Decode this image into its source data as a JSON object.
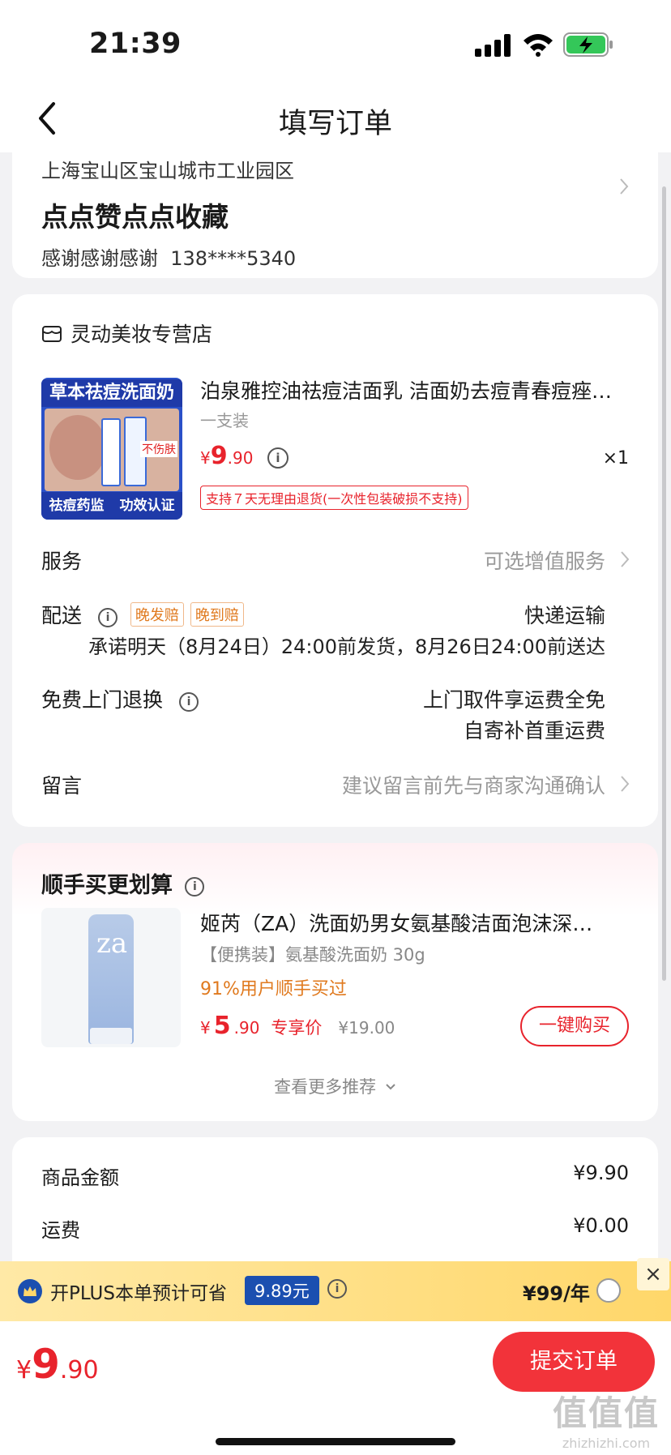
{
  "status_bar": {
    "time": "21:39"
  },
  "nav": {
    "title": "填写订单"
  },
  "address": {
    "region": "上海宝山区宝山城市工业园区",
    "detail": "点点赞点点收藏",
    "name": "感谢感谢感谢",
    "phone": "138****5340"
  },
  "shop": {
    "name": "灵动美妆专营店"
  },
  "product": {
    "name": "泊泉雅控油祛痘洁面乳 洁面奶去痘青春痘痤疮…",
    "spec": "一支装",
    "price_currency": "¥",
    "price_int": "9",
    "price_dec": ".90",
    "qty": "×1",
    "return_policy": "支持７天无理由退货(一次性包装破损不支持)",
    "thumb_title": "草本祛痘洗面奶",
    "thumb_tag": "不伤肤",
    "thumb_bottom_left": "祛痘药监",
    "thumb_bottom_right": "功效认证"
  },
  "rows": {
    "service_label": "服务",
    "service_value": "可选增值服务",
    "delivery_label": "配送",
    "delivery_tag1": "晚发赔",
    "delivery_tag2": "晚到赔",
    "delivery_method": "快递运输",
    "delivery_promise": "承诺明天（8月24日）24:00前发货，8月26日24:00前送达",
    "return_label": "免费上门退换",
    "return_line1": "上门取件享运费全免",
    "return_line2": "自寄补首重运费",
    "note_label": "留言",
    "note_placeholder": "建议留言前先与商家沟通确认"
  },
  "recommend": {
    "title": "顺手买更划算",
    "name": "姬芮（ZA）洗面奶男女氨基酸洁面泡沫深…",
    "spec": "【便携装】氨基酸洗面奶 30g",
    "sold": "91%用户顺手买过",
    "price_currency": "¥",
    "price_int": "5",
    "price_dec": ".90",
    "price_label": "专享价",
    "orig_price": "¥19.00",
    "buy_label": "一键购买",
    "more_label": "查看更多推荐",
    "brand_mark": "za"
  },
  "summary": {
    "goods_label": "商品金额",
    "goods_value": "¥9.90",
    "shipping_label": "运费",
    "shipping_value": "¥0.00"
  },
  "plus": {
    "text": "开PLUS本单预计可省",
    "amount": "9.89元",
    "price": "¥99/年",
    "close": "×"
  },
  "bottom": {
    "currency": "¥",
    "total_int": "9",
    "total_dec": ".90",
    "submit_label": "提交订单",
    "watermark_main": "值值值",
    "watermark_sub": "zhizhizhi.com"
  },
  "colors": {
    "accent": "#e8232c",
    "plus_blue": "#1b4fb0",
    "orange": "#e07a1f"
  }
}
